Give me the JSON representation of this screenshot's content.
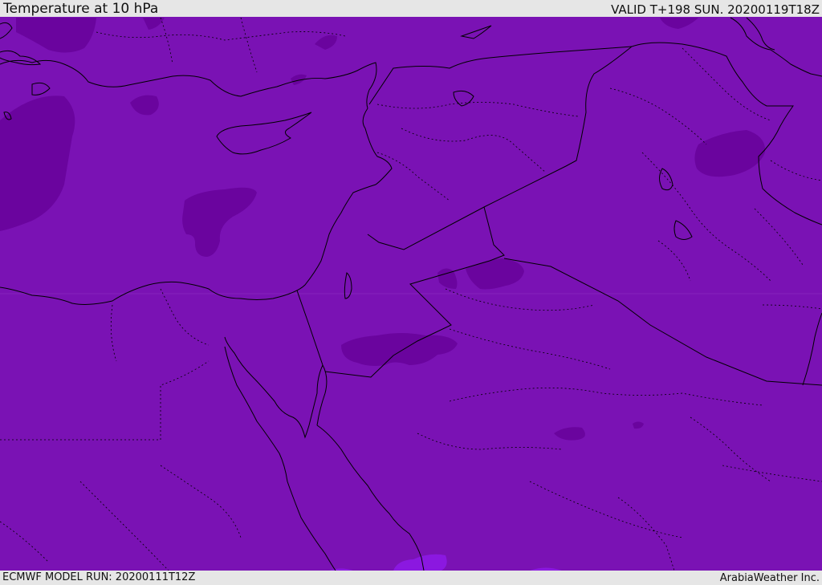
{
  "header": {
    "title": "Temperature at 10 hPa",
    "valid": "VALID T+198 SUN. 20200119T18Z"
  },
  "footer": {
    "model_run": "ECMWF MODEL RUN: 20200111T12Z",
    "credit": "ArabiaWeather Inc."
  },
  "colors": {
    "background": "#e6e6e6",
    "field_main": "#7a12b4",
    "field_cold": "#6a049e",
    "field_warm": "#8b18e0",
    "coastline": "#000000"
  }
}
